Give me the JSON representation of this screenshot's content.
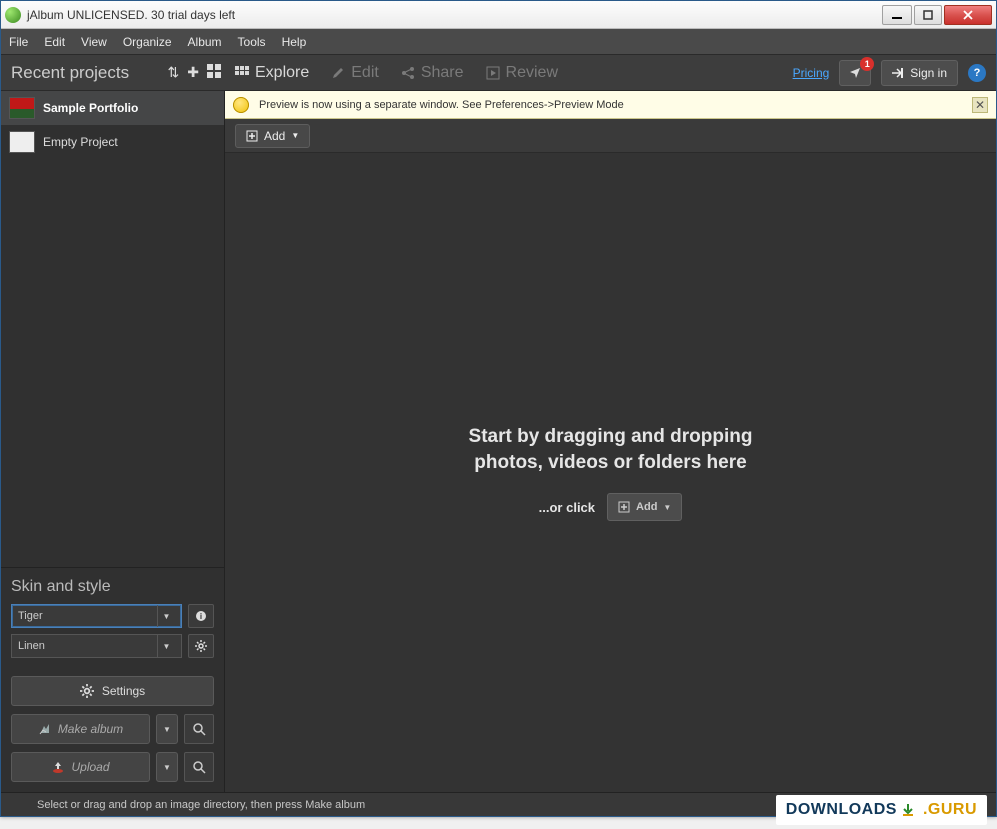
{
  "title": "jAlbum UNLICENSED. 30 trial days left",
  "menus": [
    "File",
    "Edit",
    "View",
    "Organize",
    "Album",
    "Tools",
    "Help"
  ],
  "sidebar_header": "Recent projects",
  "projects": [
    {
      "name": "Sample Portfolio",
      "selected": true,
      "thumb": "flower"
    },
    {
      "name": "Empty Project",
      "selected": false,
      "thumb": "page"
    }
  ],
  "tabs": [
    {
      "label": "Explore",
      "icon": "grid",
      "active": true
    },
    {
      "label": "Edit",
      "icon": "pencil",
      "active": false
    },
    {
      "label": "Share",
      "icon": "share",
      "active": false
    },
    {
      "label": "Review",
      "icon": "play",
      "active": false
    }
  ],
  "top_right": {
    "pricing": "Pricing",
    "notif_count": "1",
    "signin": "Sign in"
  },
  "info_bar": "Preview is now using a separate window. See Preferences->Preview Mode",
  "toolbar": {
    "add": "Add"
  },
  "drop": {
    "line1": "Start by dragging and dropping",
    "line2": "photos, videos or folders here",
    "or": "...or click",
    "add": "Add"
  },
  "skin": {
    "title": "Skin and style",
    "skin_value": "Tiger",
    "style_value": "Linen"
  },
  "actions": {
    "settings": "Settings",
    "make": "Make album",
    "upload": "Upload"
  },
  "status": "Select or drag and drop an image directory, then press Make album",
  "watermark": {
    "a": "DOWNLOADS",
    "b": ".GURU"
  }
}
